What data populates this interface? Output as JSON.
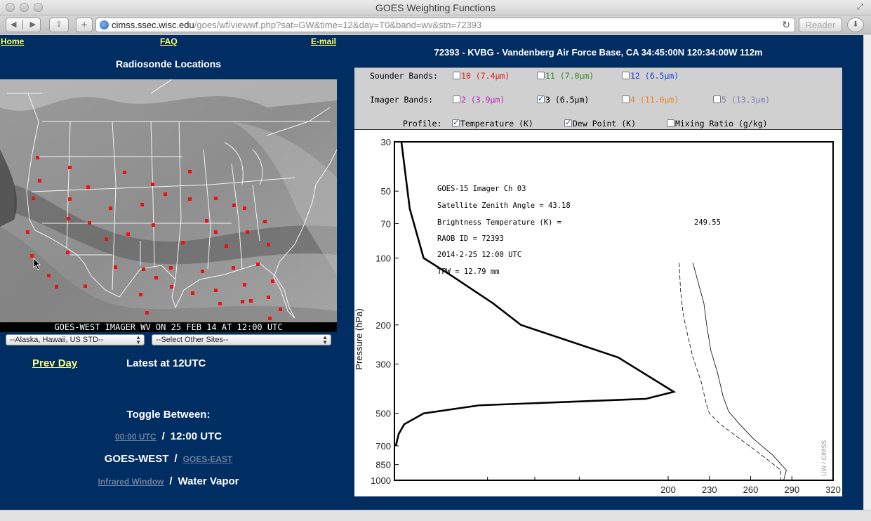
{
  "browser": {
    "window_title": "GOES Weighting Functions",
    "url_host": "cimss.ssec.wisc.edu",
    "url_path": "/goes/wf/viewwf.php?sat=GW&time=12&day=T0&band=wv&stn=72393",
    "reader_label": "Reader"
  },
  "nav": {
    "home": "Home",
    "faq": "FAQ",
    "email": "E-mail"
  },
  "left": {
    "title": "Radiosonde Locations",
    "map_caption": "GOES-WEST IMAGER WV ON 25 FEB 14 AT 12:00 UTC",
    "select_alaska": "--Alaska, Hawaii, US STD--",
    "select_other": "--Select Other Sites--",
    "prev_day": "Prev Day",
    "latest": "Latest at 12UTC",
    "toggle_title": "Toggle Between:",
    "time_other": "00:00 UTC",
    "time_current": "12:00 UTC",
    "sat_current": "GOES-WEST",
    "sat_other": "GOES-EAST",
    "band_other": "Infrared Window",
    "band_current": "Water Vapor",
    "separator": "/",
    "marker_color": "#ee1111"
  },
  "right": {
    "station_title": "72393 - KVBG - Vandenberg Air Force Base, CA 34:45:00N 120:34:00W 112m",
    "sounder_label": "Sounder Bands:",
    "imager_label": "Imager  Bands:",
    "profile_label": "Profile:",
    "sounder_bands": [
      {
        "num": "10",
        "wl": "(7.4µm)",
        "color": "#e01a1a",
        "checked": false
      },
      {
        "num": "11",
        "wl": "(7.0µm)",
        "color": "#2a8a2a",
        "checked": false
      },
      {
        "num": "12",
        "wl": "(6.5µm)",
        "color": "#1a3fe0",
        "checked": false
      }
    ],
    "imager_bands": [
      {
        "num": "2",
        "wl": "(3.9µm)",
        "color": "#c020c0",
        "checked": false
      },
      {
        "num": "3",
        "wl": "(6.5µm)",
        "color": "#000000",
        "checked": true
      },
      {
        "num": "4",
        "wl": "(11.0µm)",
        "color": "#f08020",
        "checked": false
      },
      {
        "num": "5",
        "wl": "(13.3µm)",
        "color": "#7d7db5",
        "checked": false
      }
    ],
    "profiles": [
      {
        "label": "Temperature (K)",
        "checked": true
      },
      {
        "label": "Dew Point (K)",
        "checked": true
      },
      {
        "label": "Mixing Ratio (g/kg)",
        "checked": false
      }
    ]
  },
  "chart_data": {
    "type": "line",
    "title": "",
    "ylabel": "Pressure (hPa)",
    "xlabel": "",
    "y_scale": "log",
    "y_reversed": true,
    "ylim": [
      1000,
      30
    ],
    "y_ticks": [
      30,
      50,
      70,
      100,
      200,
      300,
      500,
      700,
      850,
      1000
    ],
    "x_ticks": [
      200,
      230,
      260,
      290,
      320
    ],
    "xlim": [
      200,
      320
    ],
    "watermark": "UW / CIMSS",
    "annotations": [
      "GOES-15 Imager  Ch    03",
      "Satellite Zenith Angle = 43.18",
      "Brightness Temperature (K) =",
      "249.55",
      "RAOB ID = 72393",
      "2014-2-25 12:00 UTC",
      "TPW = 12.79 mm"
    ],
    "series": [
      {
        "name": "",
        "style": "thick",
        "x": [
          0.02,
          0.05,
          0.1,
          0.2,
          0.35,
          0.45,
          0.8,
          1.0,
          0.9,
          0.3,
          0.1,
          0.03,
          0.01,
          0.0
        ],
        "y": [
          30,
          60,
          100,
          120,
          160,
          200,
          280,
          400,
          430,
          460,
          500,
          560,
          620,
          700
        ]
      },
      {
        "name": "",
        "style": "solid",
        "x": [
          218,
          222,
          226,
          228,
          231,
          236,
          240,
          244,
          252,
          262,
          276,
          286,
          284
        ],
        "y": [
          105,
          130,
          160,
          200,
          260,
          330,
          420,
          490,
          560,
          650,
          770,
          900,
          1000
        ]
      },
      {
        "name": "",
        "style": "dashed",
        "x": [
          208,
          209,
          211,
          214,
          218,
          224,
          228,
          230,
          238,
          252,
          268,
          282,
          282
        ],
        "y": [
          105,
          140,
          180,
          220,
          280,
          360,
          460,
          500,
          560,
          650,
          770,
          900,
          1000
        ]
      }
    ]
  }
}
